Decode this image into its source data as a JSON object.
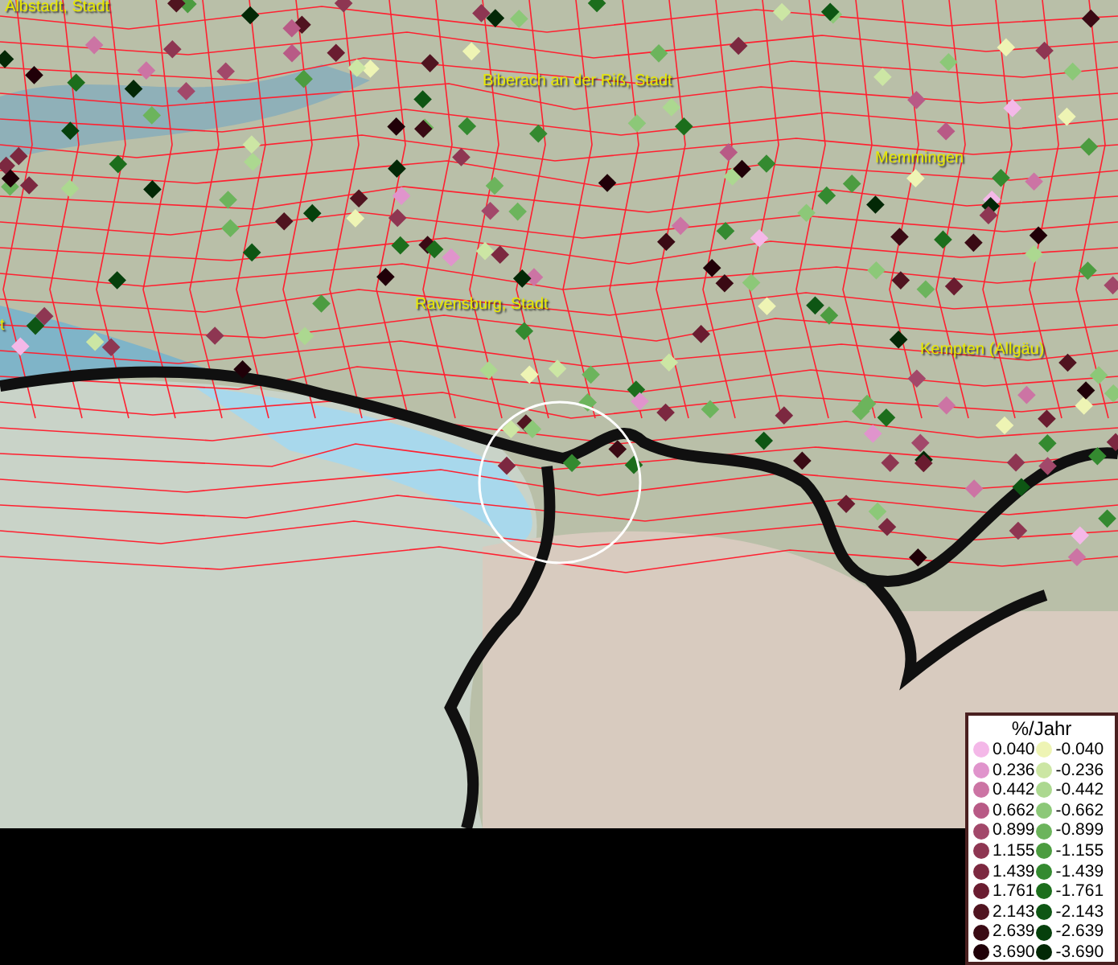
{
  "map_labels": [
    "Albstadt, Stadt",
    "Biberach an der Riß, Stadt",
    "Memmingen",
    "Ravensburg, Stadt",
    "t",
    "Kempten (Allgäu)"
  ],
  "legend": {
    "title": "%/Jahr",
    "columns": [
      {
        "entries": [
          {
            "value": "0.040",
            "color": "#f4b8e8"
          },
          {
            "value": "0.236",
            "color": "#e094cc"
          },
          {
            "value": "0.442",
            "color": "#cc74a4"
          },
          {
            "value": "0.662",
            "color": "#b85a86"
          },
          {
            "value": "0.899",
            "color": "#a2486a"
          },
          {
            "value": "1.155",
            "color": "#8e3652"
          },
          {
            "value": "1.439",
            "color": "#7c2840"
          },
          {
            "value": "1.761",
            "color": "#6a1c30"
          },
          {
            "value": "2.143",
            "color": "#501420"
          },
          {
            "value": "2.639",
            "color": "#3a0a14"
          },
          {
            "value": "3.690",
            "color": "#200008"
          }
        ]
      },
      {
        "entries": [
          {
            "value": "-0.040",
            "color": "#eef4b4"
          },
          {
            "value": "-0.236",
            "color": "#cce6a4"
          },
          {
            "value": "-0.442",
            "color": "#acd890"
          },
          {
            "value": "-0.662",
            "color": "#8cc878"
          },
          {
            "value": "-0.899",
            "color": "#6cb45c"
          },
          {
            "value": "-1.155",
            "color": "#4c9c40"
          },
          {
            "value": "-1.439",
            "color": "#348a30"
          },
          {
            "value": "-1.761",
            "color": "#1c6e1c"
          },
          {
            "value": "-2.143",
            "color": "#0e5614"
          },
          {
            "value": "-2.639",
            "color": "#06400c"
          },
          {
            "value": "-3.690",
            "color": "#032806"
          }
        ]
      }
    ]
  }
}
